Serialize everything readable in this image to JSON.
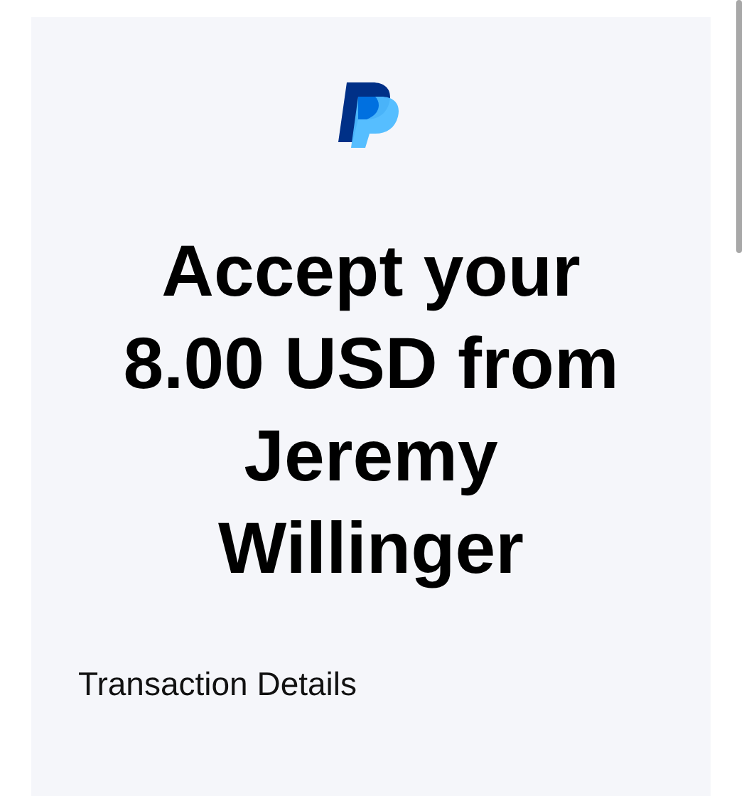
{
  "heading": "Accept your 8.00 USD from Jeremy Willinger",
  "section_title": "Transaction Details"
}
